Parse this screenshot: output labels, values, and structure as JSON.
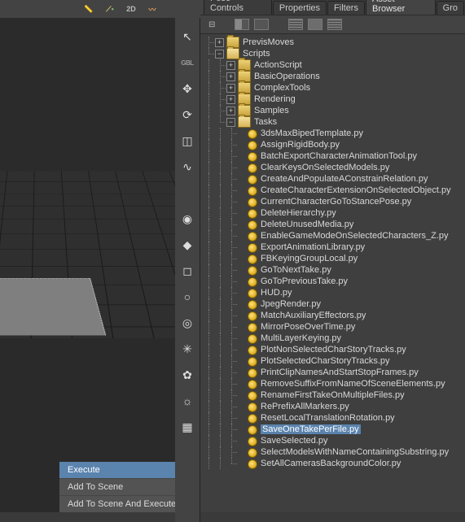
{
  "top_icons": {
    "ruler": "ruler-icon",
    "arc": "arc-icon",
    "mode2d": "2D",
    "brush": "brush-icon"
  },
  "tabs": [
    {
      "label": "Pose Controls",
      "active": false,
      "name": "tab-pose-controls"
    },
    {
      "label": "Properties",
      "active": false,
      "name": "tab-properties"
    },
    {
      "label": "Filters",
      "active": false,
      "name": "tab-filters"
    },
    {
      "label": "Asset Browser",
      "active": true,
      "name": "tab-asset-browser"
    },
    {
      "label": "Gro",
      "active": false,
      "name": "tab-groups"
    }
  ],
  "context_menu": [
    "Execute",
    "Add To Scene",
    "Add To Scene And Execute"
  ],
  "tool_column": [
    {
      "name": "select-tool-icon",
      "glyph": "↖"
    },
    {
      "name": "global-mode-icon",
      "glyph": "",
      "text": "GBL"
    },
    {
      "name": "move-tool-icon",
      "glyph": "✥"
    },
    {
      "name": "rotate-tool-icon",
      "glyph": "⟳"
    },
    {
      "name": "scale-tool-icon",
      "glyph": "◫"
    },
    {
      "name": "spline-tool-icon",
      "glyph": "∿"
    },
    {
      "name": "divider1",
      "glyph": ""
    },
    {
      "name": "globe-dot-icon",
      "glyph": "◉"
    },
    {
      "name": "hierarchy-color-icon",
      "glyph": "◆"
    },
    {
      "name": "cube-icon",
      "glyph": "◻"
    },
    {
      "name": "sphere-icon",
      "glyph": "○"
    },
    {
      "name": "torus-icon",
      "glyph": "◎"
    },
    {
      "name": "star-burst-icon",
      "glyph": "✳"
    },
    {
      "name": "gear-icon",
      "glyph": "✿"
    },
    {
      "name": "sun-icon",
      "glyph": "☼"
    },
    {
      "name": "wireframe-icon",
      "glyph": "▦"
    }
  ],
  "tree": {
    "top": [
      {
        "name": "PrevisMoves",
        "icon": "folder-closed",
        "toggle": "+",
        "depth": 0
      },
      {
        "name": "Scripts",
        "icon": "folder-open",
        "toggle": "−",
        "depth": 0
      }
    ],
    "scripts_children": [
      {
        "name": "ActionScript",
        "icon": "folder-closed",
        "toggle": "+"
      },
      {
        "name": "BasicOperations",
        "icon": "folder-closed",
        "toggle": "+"
      },
      {
        "name": "ComplexTools",
        "icon": "folder-closed",
        "toggle": "+"
      },
      {
        "name": "Rendering",
        "icon": "folder-closed",
        "toggle": "+"
      },
      {
        "name": "Samples",
        "icon": "folder-closed",
        "toggle": "+"
      },
      {
        "name": "Tasks",
        "icon": "folder-open",
        "toggle": "−"
      }
    ],
    "files": [
      "3dsMaxBipedTemplate.py",
      "AssignRigidBody.py",
      "BatchExportCharacterAnimationTool.py",
      "ClearKeysOnSelectedModels.py",
      "CreateAndPopulateAConstrainRelation.py",
      "CreateCharacterExtensionOnSelectedObject.py",
      "CurrentCharacterGoToStancePose.py",
      "DeleteHierarchy.py",
      "DeleteUnusedMedia.py",
      "EnableGameModeOnSelectedCharacters_Z.py",
      "ExportAnimationLibrary.py",
      "FBKeyingGroupLocal.py",
      "GoToNextTake.py",
      "GoToPreviousTake.py",
      "HUD.py",
      "JpegRender.py",
      "MatchAuxiliaryEffectors.py",
      "MirrorPoseOverTime.py",
      "MultiLayerKeying.py",
      "PlotNonSelectedCharStoryTracks.py",
      "PlotSelectedCharStoryTracks.py",
      "PrintClipNamesAndStartStopFrames.py",
      "RemoveSuffixFromNameOfSceneElements.py",
      "RenameFirstTakeOnMultipleFiles.py",
      "RePrefixAllMarkers.py",
      "ResetLocalTranslationRotation.py",
      "SaveOneTakePerFile.py",
      "SaveSelected.py",
      "SelectModelsWithNameContainingSubstring.py",
      "SetAllCamerasBackgroundColor.py"
    ],
    "selected_file": "SaveOneTakePerFile.py"
  }
}
